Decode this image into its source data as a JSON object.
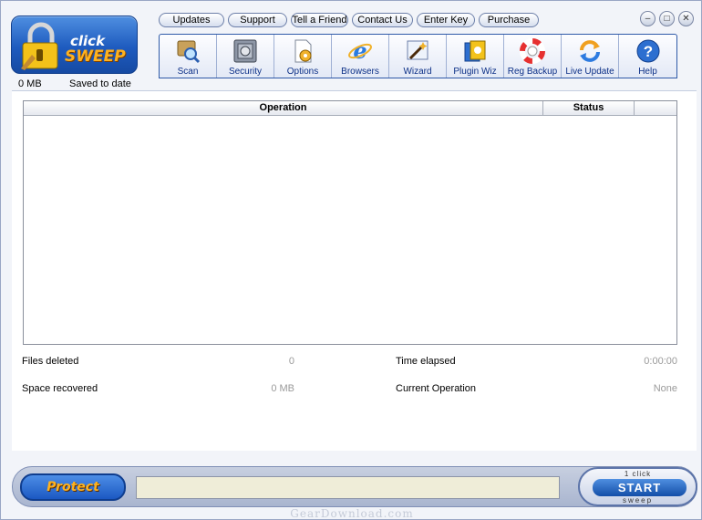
{
  "logo": {
    "word1": "click",
    "word2": "SWEEP"
  },
  "saved": {
    "amount": "0 MB",
    "label": "Saved to date"
  },
  "links": [
    "Updates",
    "Support",
    "Tell a Friend",
    "Contact Us",
    "Enter Key",
    "Purchase"
  ],
  "toolbar": [
    "Scan",
    "Security",
    "Options",
    "Browsers",
    "Wizard",
    "Plugin Wiz",
    "Reg Backup",
    "Live Update",
    "Help"
  ],
  "grid": {
    "col_operation": "Operation",
    "col_status": "Status"
  },
  "stats": {
    "files_deleted_label": "Files deleted",
    "files_deleted_value": "0",
    "space_recovered_label": "Space recovered",
    "space_recovered_value": "0 MB",
    "time_elapsed_label": "Time elapsed",
    "time_elapsed_value": "0:00:00",
    "current_operation_label": "Current Operation",
    "current_operation_value": "None"
  },
  "bottom": {
    "protect_label": "Protect",
    "start_top": "1 click",
    "start_label": "START",
    "start_bottom": "sweep"
  },
  "watermark": "GearDownload.com",
  "colors": {
    "accent": "#1e5bbf",
    "brand_orange": "#ffb21e",
    "link_text": "#0b2f86"
  }
}
